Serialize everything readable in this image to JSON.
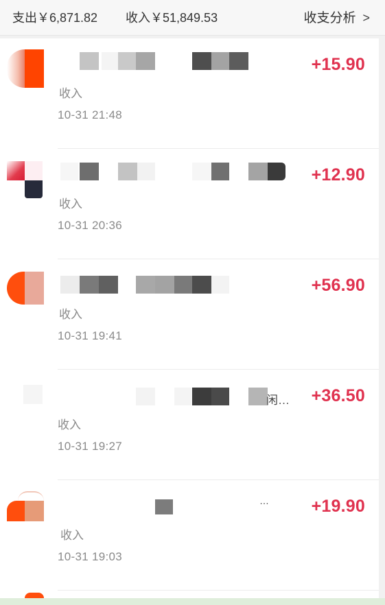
{
  "header": {
    "expense_label": "支出￥6,871.82",
    "income_label": "收入￥51,849.53",
    "analysis_label": "收支分析",
    "analysis_chevron": ">"
  },
  "transactions": [
    {
      "type": "收入",
      "time": "10-31 21:48",
      "amount": "+15.90",
      "trail": ""
    },
    {
      "type": "收入",
      "time": "10-31 20:36",
      "amount": "+12.90",
      "trail": ""
    },
    {
      "type": "收入",
      "time": "10-31 19:41",
      "amount": "+56.90",
      "trail": ""
    },
    {
      "type": "收入",
      "time": "10-31 19:27",
      "amount": "+36.50",
      "trail": "闲…"
    },
    {
      "type": "收入",
      "time": "10-31 19:03",
      "amount": "+19.90",
      "trail": "…"
    }
  ],
  "colors": {
    "amount": "#e0324f",
    "secondary_text": "#8a8a8a",
    "logo_orange": "#ff4400"
  }
}
